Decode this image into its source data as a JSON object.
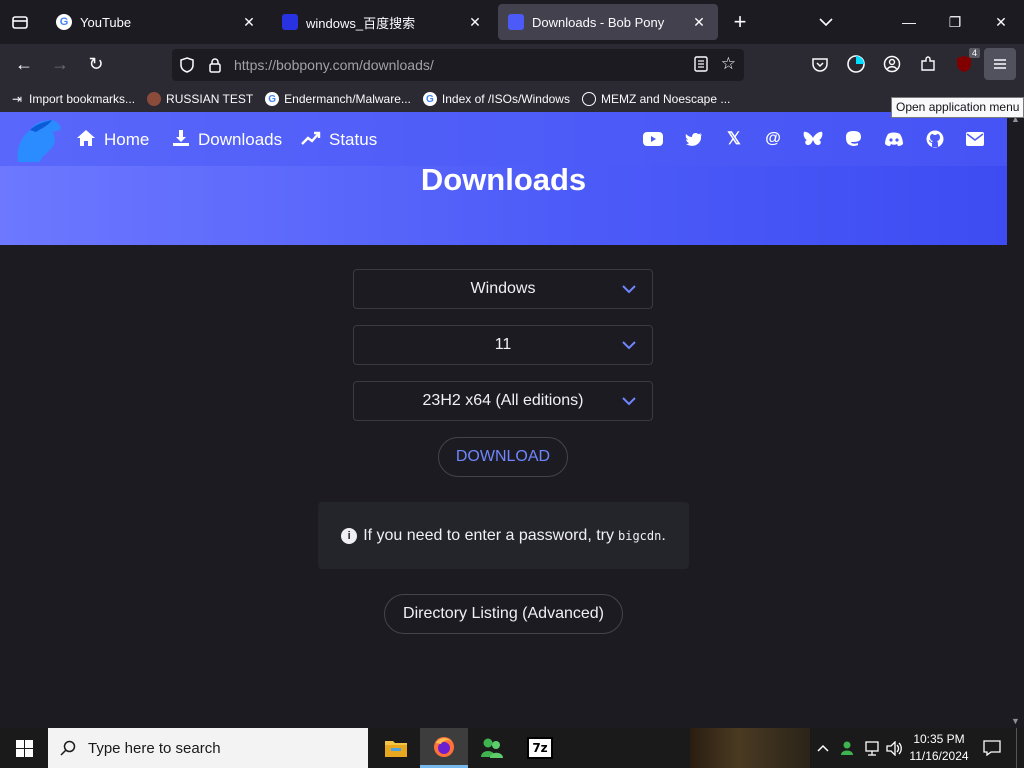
{
  "browser": {
    "tabs": [
      {
        "label": "YouTube",
        "active": false,
        "icon": "google-icon"
      },
      {
        "label": "windows_百度搜索",
        "active": false,
        "icon": "baidu-icon"
      },
      {
        "label": "Downloads - Bob Pony",
        "active": true,
        "icon": "bobpony-icon"
      }
    ],
    "url_host": "https://bobpony.com",
    "url_path": "/downloads/",
    "bookmarks": [
      {
        "label": "Import bookmarks...",
        "icon": "import-icon"
      },
      {
        "label": "RUSSIAN TEST",
        "icon": "magnifier-icon"
      },
      {
        "label": "Endermanch/Malware...",
        "icon": "google-icon"
      },
      {
        "label": "Index of /ISOs/Windows",
        "icon": "google-icon"
      },
      {
        "label": "MEMZ and Noescape ...",
        "icon": "globe-icon"
      }
    ],
    "ublock_badge": "4",
    "tooltip": "Open application menu"
  },
  "site": {
    "nav": {
      "home": "Home",
      "downloads": "Downloads",
      "status": "Status"
    },
    "social": [
      "youtube-icon",
      "twitter-icon",
      "x-icon",
      "threads-icon",
      "bluesky-icon",
      "mastodon-icon",
      "discord-icon",
      "github-icon",
      "mail-icon"
    ],
    "title": "Downloads",
    "selects": {
      "os": "Windows",
      "version": "11",
      "build": "23H2 x64 (All editions)"
    },
    "download_label": "DOWNLOAD",
    "notice_text": "If you need to enter a password, try",
    "notice_code": "bigcdn",
    "notice_end": ".",
    "dirlist_label": "Directory Listing (Advanced)"
  },
  "taskbar": {
    "search_placeholder": "Type here to search",
    "time": "10:35 PM",
    "date": "11/16/2024"
  },
  "colors": {
    "accent": "#4c5af7",
    "link": "#6f86ff",
    "page_bg": "#1c1b22"
  }
}
